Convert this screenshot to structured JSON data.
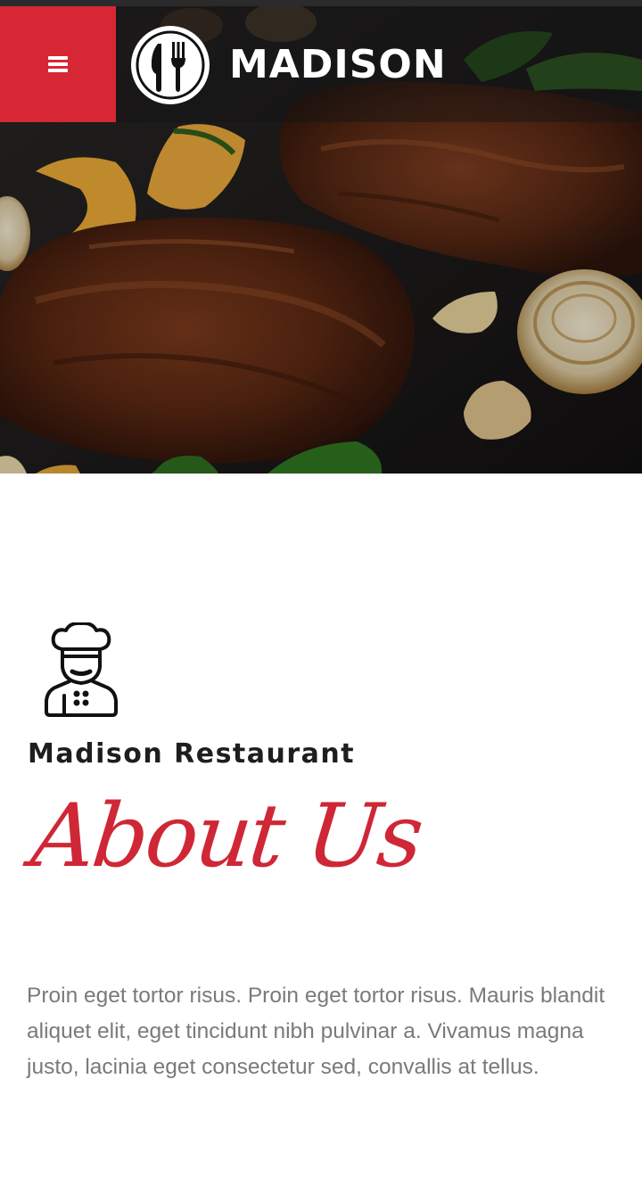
{
  "header": {
    "menu_icon": "hamburger-menu-icon",
    "logo_icon": "fork-knife-circle-icon",
    "logo_text": "MADISON"
  },
  "hero": {
    "image": "grilled-steaks-with-vegetables"
  },
  "about": {
    "icon": "chef-icon",
    "subtitle": "Madison Restaurant",
    "title": "About Us",
    "body": "Proin eget tortor risus. Proin eget tortor risus. Mauris blandit aliquet elit, eget tincidunt nibh pulvinar a. Vivamus magna justo, lacinia eget consectetur sed, convallis at tellus."
  },
  "colors": {
    "accent": "#d72735",
    "script": "#cf2736",
    "text": "#7a7a7a",
    "heading": "#1e1e1e"
  }
}
